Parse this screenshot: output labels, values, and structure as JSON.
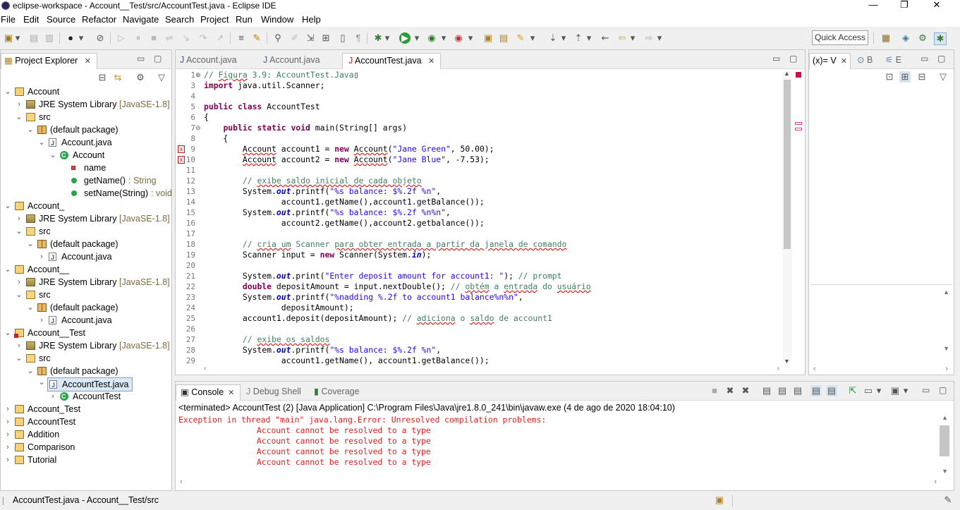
{
  "window": {
    "title": "eclipse-workspace - Account__Test/src/AccountTest.java - Eclipse IDE",
    "minimize": "—",
    "maximize": "❐",
    "close": "✕"
  },
  "menu": [
    "File",
    "Edit",
    "Source",
    "Refactor",
    "Navigate",
    "Search",
    "Project",
    "Run",
    "Window",
    "Help"
  ],
  "toolbar": {
    "quick_access_placeholder": "Quick Access"
  },
  "explorer": {
    "title": "Project Explorer",
    "tree": [
      {
        "label": "Account",
        "extra": "",
        "type": "proj",
        "depth": 0,
        "twisty": "v"
      },
      {
        "label": "JRE System Library",
        "extra": "[JavaSE-1.8]",
        "type": "lib",
        "depth": 1,
        "twisty": ">"
      },
      {
        "label": "src",
        "extra": "",
        "type": "src",
        "depth": 1,
        "twisty": "v"
      },
      {
        "label": "(default package)",
        "extra": "",
        "type": "pkg",
        "depth": 2,
        "twisty": "v"
      },
      {
        "label": "Account.java",
        "extra": "",
        "type": "java",
        "depth": 3,
        "twisty": "v"
      },
      {
        "label": "Account",
        "extra": "",
        "type": "class",
        "depth": 4,
        "twisty": "v"
      },
      {
        "label": "name",
        "extra": "",
        "type": "field",
        "depth": 5,
        "twisty": ""
      },
      {
        "label": "getName()",
        "extra": ": String",
        "type": "method",
        "depth": 5,
        "twisty": ""
      },
      {
        "label": "setName(String)",
        "extra": ": void",
        "type": "method",
        "depth": 5,
        "twisty": ""
      },
      {
        "label": "Account_",
        "extra": "",
        "type": "proj",
        "depth": 0,
        "twisty": "v"
      },
      {
        "label": "JRE System Library",
        "extra": "[JavaSE-1.8]",
        "type": "lib",
        "depth": 1,
        "twisty": ">"
      },
      {
        "label": "src",
        "extra": "",
        "type": "src",
        "depth": 1,
        "twisty": "v"
      },
      {
        "label": "(default package)",
        "extra": "",
        "type": "pkg",
        "depth": 2,
        "twisty": "v"
      },
      {
        "label": "Account.java",
        "extra": "",
        "type": "java",
        "depth": 3,
        "twisty": ">"
      },
      {
        "label": "Account__",
        "extra": "",
        "type": "proj",
        "depth": 0,
        "twisty": "v"
      },
      {
        "label": "JRE System Library",
        "extra": "[JavaSE-1.8]",
        "type": "lib",
        "depth": 1,
        "twisty": ">"
      },
      {
        "label": "src",
        "extra": "",
        "type": "src",
        "depth": 1,
        "twisty": "v"
      },
      {
        "label": "(default package)",
        "extra": "",
        "type": "pkg",
        "depth": 2,
        "twisty": "v"
      },
      {
        "label": "Account.java",
        "extra": "",
        "type": "java",
        "depth": 3,
        "twisty": ">"
      },
      {
        "label": "Account__Test",
        "extra": "",
        "type": "projerr",
        "depth": 0,
        "twisty": "v"
      },
      {
        "label": "JRE System Library",
        "extra": "[JavaSE-1.8]",
        "type": "lib",
        "depth": 1,
        "twisty": ">"
      },
      {
        "label": "src",
        "extra": "",
        "type": "src",
        "depth": 1,
        "twisty": "v"
      },
      {
        "label": "(default package)",
        "extra": "",
        "type": "pkg",
        "depth": 2,
        "twisty": "v"
      },
      {
        "label": "AccountTest.java",
        "extra": "",
        "type": "java",
        "depth": 3,
        "twisty": "v",
        "selected": true
      },
      {
        "label": "AccountTest",
        "extra": "",
        "type": "class",
        "depth": 4,
        "twisty": ">"
      },
      {
        "label": "Account_Test",
        "extra": "",
        "type": "proj",
        "depth": 0,
        "twisty": ">"
      },
      {
        "label": "AccountTest",
        "extra": "",
        "type": "proj",
        "depth": 0,
        "twisty": ">"
      },
      {
        "label": "Addition",
        "extra": "",
        "type": "proj",
        "depth": 0,
        "twisty": ">"
      },
      {
        "label": "Comparison",
        "extra": "",
        "type": "proj",
        "depth": 0,
        "twisty": ">"
      },
      {
        "label": "Tutorial",
        "extra": "",
        "type": "proj",
        "depth": 0,
        "twisty": ">"
      }
    ]
  },
  "editor": {
    "tabs": [
      {
        "label": "Account.java",
        "active": false
      },
      {
        "label": "Account.java",
        "active": false
      },
      {
        "label": "AccountTest.java",
        "active": true
      }
    ],
    "lines": [
      {
        "n": "1",
        "fold": "⊕",
        "html": "<span class=\"cm\">// <span class=\"err\">Figura</span> 3.9: AccountTest.Java</span>▯"
      },
      {
        "n": "3",
        "html": "<span class=\"kw\">import</span> java.util.Scanner;"
      },
      {
        "n": "4",
        "html": ""
      },
      {
        "n": "5",
        "html": "<span class=\"kw\">public class</span> AccountTest"
      },
      {
        "n": "6",
        "html": "{"
      },
      {
        "n": "7",
        "fold": "⊖",
        "html": "    <span class=\"kw\">public static void</span> main(String[] args)"
      },
      {
        "n": "8",
        "html": "    {"
      },
      {
        "n": "9",
        "errmark": true,
        "html": "        <span class=\"err\">Account</span> account1 = <span class=\"kw\">new</span> <span class=\"err\">Account</span>(<span class=\"str\">\"Jane Green\"</span>, 50.00);"
      },
      {
        "n": "10",
        "errmark": true,
        "html": "        <span class=\"err\">Account</span> account2 = <span class=\"kw\">new</span> <span class=\"err\">Account</span>(<span class=\"str\">\"Jane Blue\"</span>, -7.53);"
      },
      {
        "n": "11",
        "html": ""
      },
      {
        "n": "12",
        "html": "        <span class=\"cm\">// <span class=\"err\">exibe saldo inicial de cada objeto</span></span>"
      },
      {
        "n": "13",
        "html": "        System.<span class=\"st\">out</span>.printf(<span class=\"str\">\"%s balance: $%.2f %n\"</span>,"
      },
      {
        "n": "14",
        "html": "                account1.getName(),account1.getBalance());"
      },
      {
        "n": "15",
        "html": "        System.<span class=\"st\">out</span>.printf(<span class=\"str\">\"%s balance: $%.2f %n%n\"</span>,"
      },
      {
        "n": "16",
        "html": "                account2.getName(),account2.getbalance());"
      },
      {
        "n": "17",
        "html": ""
      },
      {
        "n": "18",
        "html": "        <span class=\"cm\">// <span class=\"err\">cria um</span> Scanner <span class=\"err\">para obter entrada a partir da janela de comando</span></span>"
      },
      {
        "n": "19",
        "html": "        Scanner input = <span class=\"kw\">new</span> Scanner(System.<span class=\"st\">in</span>);"
      },
      {
        "n": "20",
        "html": ""
      },
      {
        "n": "21",
        "html": "        System.<span class=\"st\">out</span>.print(<span class=\"str\">\"Enter deposit amount for account1: \"</span>); <span class=\"cm\">// prompt</span>"
      },
      {
        "n": "22",
        "html": "        <span class=\"kw\">double</span> depositAmount = input.nextDouble(); <span class=\"cm\">// <span class=\"err\">obtém</span> a <span class=\"err\">entrada</span> do <span class=\"err\">usuário</span></span>"
      },
      {
        "n": "23",
        "html": "        System.<span class=\"st\">out</span>.printf(<span class=\"str\">\"%nadding %.2f to account1 balance%n%n\"</span>,"
      },
      {
        "n": "24",
        "html": "                depositAmount);"
      },
      {
        "n": "25",
        "html": "        account1.deposit(depositAmount); <span class=\"cm\">// <span class=\"err\">adiciona</span> o <span class=\"err\">saldo</span> de account1</span>"
      },
      {
        "n": "26",
        "html": ""
      },
      {
        "n": "27",
        "html": "        <span class=\"cm\">// <span class=\"err\">exibe os saldos</span></span>"
      },
      {
        "n": "28",
        "html": "        System.<span class=\"st\">out</span>.printf(<span class=\"str\">\"%s balance: $%.2f %n\"</span>,"
      },
      {
        "n": "29",
        "html": "                account1.getName(), account1.getBalance());"
      }
    ]
  },
  "variables": {
    "tabs": [
      {
        "label": "(x)= V",
        "active": true
      },
      {
        "label": "B",
        "active": false
      },
      {
        "label": "E",
        "active": false
      }
    ]
  },
  "console": {
    "tabs": [
      {
        "label": "Console",
        "active": true
      },
      {
        "label": "Debug Shell",
        "active": false
      },
      {
        "label": "Coverage",
        "active": false
      }
    ],
    "header": "<terminated> AccountTest (2) [Java Application] C:\\Program Files\\Java\\jre1.8.0_241\\bin\\javaw.exe (4 de ago de 2020 18:04:10)",
    "lines": [
      "Exception in thread \"main\" java.lang.Error: Unresolved compilation problems: ",
      "\tAccount cannot be resolved to a type",
      "\tAccount cannot be resolved to a type",
      "\tAccount cannot be resolved to a type",
      "\tAccount cannot be resolved to a type"
    ],
    "error_color": "#e02020"
  },
  "status": {
    "text": "AccountTest.java - Account__Test/src"
  }
}
